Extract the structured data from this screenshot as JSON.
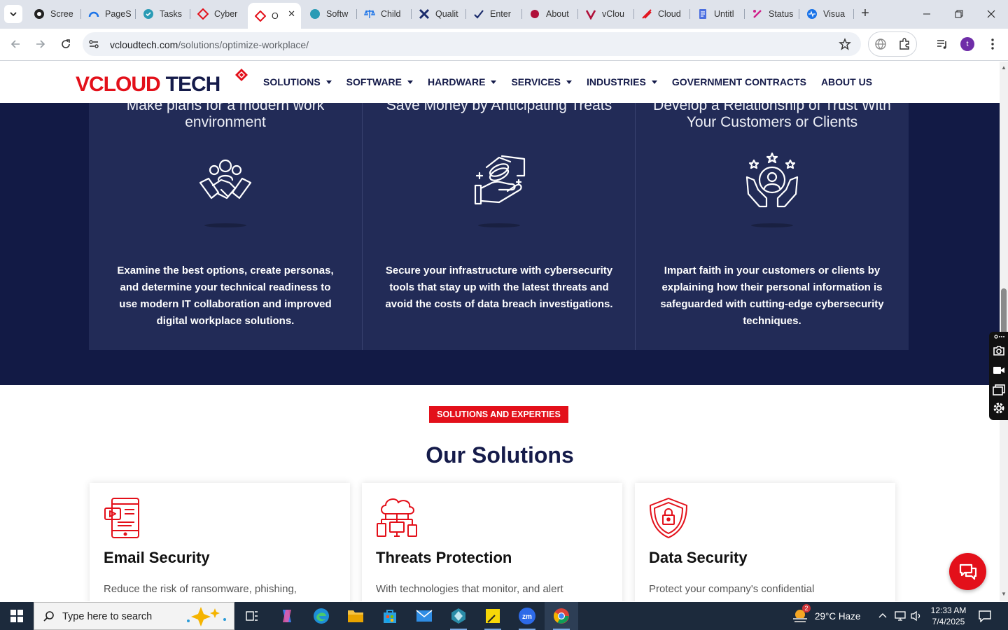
{
  "browser": {
    "tabs": [
      {
        "label": "Scree",
        "icon": "screencast-icon"
      },
      {
        "label": "PageS",
        "icon": "pagespeed-icon"
      },
      {
        "label": "Tasks",
        "icon": "tasks-icon"
      },
      {
        "label": "Cyber",
        "icon": "vcloud-diamond-icon"
      },
      {
        "label": "O",
        "icon": "vcloud-diamond-icon",
        "active": true
      },
      {
        "label": "Softw",
        "icon": "edge-page-icon"
      },
      {
        "label": "Child",
        "icon": "scales-icon"
      },
      {
        "label": "Qualit",
        "icon": "x-mark-icon"
      },
      {
        "label": "Enter",
        "icon": "checkmark-icon"
      },
      {
        "label": "About",
        "icon": "about-icon"
      },
      {
        "label": "vClou",
        "icon": "v-logo-icon"
      },
      {
        "label": "Cloud",
        "icon": "swoosh-icon"
      },
      {
        "label": "Untitl",
        "icon": "docs-icon"
      },
      {
        "label": "Status",
        "icon": "status-icon"
      },
      {
        "label": "Visua",
        "icon": "pulse-icon"
      }
    ],
    "url_host": "vcloudtech.com",
    "url_path": "/solutions/optimize-workplace/",
    "profile_initial": "t"
  },
  "site": {
    "logo": {
      "v": "V",
      "cloud": "CLOUD",
      "tech": "TECH"
    },
    "nav": [
      {
        "label": "SOLUTIONS",
        "dropdown": true
      },
      {
        "label": "SOFTWARE",
        "dropdown": true
      },
      {
        "label": "HARDWARE",
        "dropdown": true
      },
      {
        "label": "SERVICES",
        "dropdown": true
      },
      {
        "label": "INDUSTRIES",
        "dropdown": true
      },
      {
        "label": "GOVERNMENT CONTRACTS",
        "dropdown": false
      },
      {
        "label": "ABOUT US",
        "dropdown": false
      }
    ],
    "features": [
      {
        "title": "Make plans for a modern work environment",
        "description": "Examine the best options, create personas, and determine your technical readiness to use modern IT collaboration and improved digital workplace solutions.",
        "icon": "team-handshake-icon"
      },
      {
        "title": "Save Money by Anticipating Treats",
        "description": "Secure your infrastructure with cybersecurity tools that stay up with the latest threats and avoid the costs of data breach investigations.",
        "icon": "coin-hands-icon"
      },
      {
        "title": "Develop a Relationship of Trust With Your Customers or Clients",
        "description": "Impart faith in your customers or clients by explaining how their personal information is safeguarded with cutting-edge cybersecurity techniques.",
        "icon": "customer-care-icon"
      }
    ],
    "solutions_badge": "SOLUTIONS AND EXPERTIES",
    "solutions_title": "Our Solutions",
    "solutions": [
      {
        "title": "Email Security",
        "description": "Reduce the risk of ransomware, phishing,",
        "icon": "email-device-icon"
      },
      {
        "title": "Threats Protection",
        "description": "With technologies that monitor, and alert",
        "icon": "cloud-network-icon"
      },
      {
        "title": "Data Security",
        "description": "Protect your company's confidential",
        "icon": "shield-lock-icon"
      }
    ]
  },
  "taskbar": {
    "search_placeholder": "Type here to search",
    "weather": "29°C  Haze",
    "weather_badge": "2",
    "time": "12:33 AM",
    "date": "7/4/2025"
  },
  "colors": {
    "brand_red": "#e3101a",
    "brand_navy": "#151b4a",
    "dark_section": "#121a45",
    "card_bg": "#222b57"
  }
}
